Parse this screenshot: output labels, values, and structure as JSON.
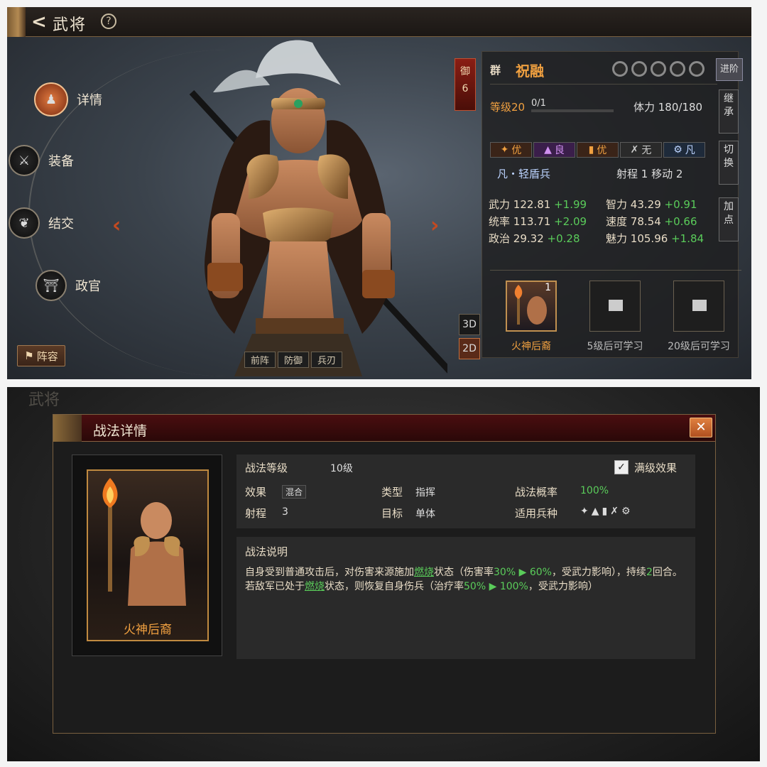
{
  "header": {
    "back_glyph": "<",
    "title": "武将",
    "help_glyph": "?"
  },
  "nav": [
    {
      "label": "详情",
      "icon": "portrait-icon",
      "glyph": "♟"
    },
    {
      "label": "装备",
      "icon": "sword-icon",
      "glyph": "⚔"
    },
    {
      "label": "结交",
      "icon": "heart-emblem-icon",
      "glyph": "❦"
    },
    {
      "label": "政官",
      "icon": "official-icon",
      "glyph": "⛩"
    }
  ],
  "lineup": {
    "icon": "flag-icon",
    "glyph": "⚑",
    "label": "阵容"
  },
  "hero_nav": {
    "prev": "‹",
    "next": "›"
  },
  "hero_tags": [
    "前阵",
    "防御",
    "兵刃"
  ],
  "view_modes": [
    "3D",
    "2D"
  ],
  "rank_badge": {
    "label": "御",
    "value": "6"
  },
  "general": {
    "faction": "群",
    "name": "祝融",
    "advance_label": "进阶",
    "level": "等级20",
    "exp": "0/1",
    "stamina": "体力 180/180"
  },
  "side_buttons": {
    "inherit": "继\n承",
    "switch": "切\n换",
    "addpoint": "加\n点"
  },
  "troop_affinity": [
    {
      "icon": "cavalry-icon",
      "glyph": "✦",
      "grade": "优",
      "bg": "#3a2418",
      "color": "#f0a040"
    },
    {
      "icon": "shield-troop-icon",
      "glyph": "▲",
      "grade": "良",
      "bg": "#3a1e4a",
      "color": "#d090f0"
    },
    {
      "icon": "shield-icon",
      "glyph": "▮",
      "grade": "优",
      "bg": "#3a2418",
      "color": "#f0a040"
    },
    {
      "icon": "bow-icon",
      "glyph": "✗",
      "grade": "无",
      "bg": "#2a2a2a",
      "color": "#ccc"
    },
    {
      "icon": "siege-icon",
      "glyph": "⚙",
      "grade": "凡",
      "bg": "#1e2a3a",
      "color": "#bcd4ff"
    }
  ],
  "unit_type": "凡・轻盾兵",
  "range_move": "射程  1   移动  2",
  "attributes": [
    {
      "name": "武力",
      "value": "122.81",
      "bonus": "+1.99"
    },
    {
      "name": "智力",
      "value": "43.29",
      "bonus": "+0.91"
    },
    {
      "name": "统率",
      "value": "113.71",
      "bonus": "+2.09"
    },
    {
      "name": "速度",
      "value": "78.54",
      "bonus": "+0.66"
    },
    {
      "name": "政治",
      "value": "29.32",
      "bonus": "+0.28"
    },
    {
      "name": "魅力",
      "value": "105.96",
      "bonus": "+1.84"
    }
  ],
  "skills": [
    {
      "label": "火神后裔",
      "level_badge": "1",
      "color": "#f0a040"
    },
    {
      "label": "5级后可学习",
      "color": "#bbb"
    },
    {
      "label": "20级后可学习",
      "color": "#bbb"
    }
  ],
  "dialog": {
    "title": "战法详情",
    "close_glyph": "✕",
    "card_name": "火神后裔",
    "skill_level_label": "战法等级",
    "skill_level_value": "10级",
    "max_effect_label": "满级效果",
    "effect_label": "效果",
    "effect_value": "混合",
    "type_label": "类型",
    "type_value": "指挥",
    "chance_label": "战法概率",
    "chance_value": "100%",
    "range_label": "射程",
    "range_value": "3",
    "target_label": "目标",
    "target_value": "单体",
    "troops_label": "适用兵种",
    "desc_title": "战法说明",
    "desc": {
      "p1": "自身受到普通攻击后，对伤害来源施加",
      "burn1": "燃烧",
      "p2": "状态（伤害率",
      "v1": "30%",
      "arrow1": "▶",
      "v2": "60%",
      "p3": "，受武力影响），持续",
      "turns": "2",
      "p4": "回合。若敌军已处于",
      "burn2": "燃烧",
      "p5": "状态，则恢复自身伤兵（治疗率",
      "v3": "50%",
      "arrow2": "▶",
      "v4": "100%",
      "p6": "，受武力影响）"
    }
  },
  "colors": {
    "accent_orange": "#f0a040",
    "bonus_green": "#5acc5a",
    "dialog_header": "#4a0e10"
  }
}
